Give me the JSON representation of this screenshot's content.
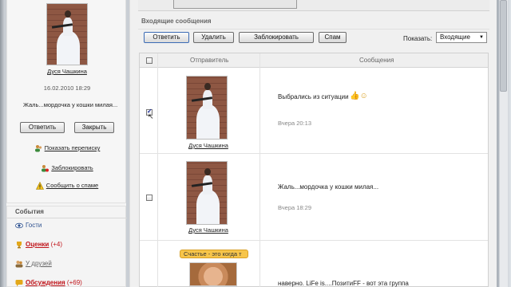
{
  "profile": {
    "name": "Дуся Чашкина",
    "date": "16.02.2010 18:29",
    "message": "Жаль...мордочка у кошки милая...",
    "reply_label": "Ответить",
    "close_label": "Закрыть",
    "links": {
      "show_conversation": "Показать переписку",
      "block": "Заблокировать",
      "report_spam": "Сообщить о спаме"
    }
  },
  "events": {
    "title": "События",
    "items": [
      {
        "label": "Гости",
        "count": ""
      },
      {
        "label": "Оценки",
        "count": "(+4)"
      },
      {
        "label": "У друзей",
        "count": ""
      },
      {
        "label": "Обсуждения",
        "count": "(+69)"
      }
    ]
  },
  "inbox": {
    "title": "Входящие сообщения",
    "toolbar": {
      "reply": "Ответить",
      "delete": "Удалить",
      "block": "Заблокировать",
      "spam": "Спам"
    },
    "show_label": "Показать:",
    "show_value": "Входящие",
    "columns": {
      "sender": "Отправитель",
      "message": "Сообщения"
    },
    "rows": [
      {
        "sender": "Дуся Чашкина",
        "text": "Выбрались из ситуации",
        "time": "Вчера 20:13",
        "checked": true
      },
      {
        "sender": "Дуся Чашкина",
        "text": "Жаль...мордочка у кошки милая...",
        "time": "Вчера 18:29",
        "checked": false
      },
      {
        "sender": "",
        "tooltip": "Счастье - это когда т",
        "text": "наверно. LiFe is....ПозитиFF - вот эта группа",
        "time": "",
        "checked": false
      }
    ]
  },
  "colors": {
    "accent_red": "#c0141a",
    "tooltip_bg": "#f7c54a"
  },
  "icons": [
    "users-icon",
    "block-user-icon",
    "warning-icon",
    "eye-icon",
    "trophy-icon",
    "friends-icon",
    "discussion-icon",
    "pointer-cursor-icon",
    "smiley-icon"
  ]
}
